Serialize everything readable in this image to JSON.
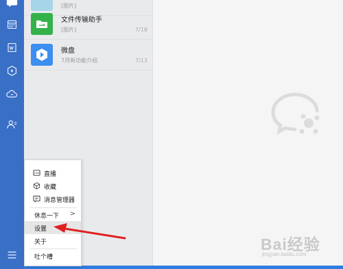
{
  "rail": {
    "color": "#3a6fc6",
    "icons": [
      "chat-icon",
      "calendar-icon",
      "document-icon",
      "play-icon",
      "cloud-icon",
      "contacts-icon",
      "menu-icon"
    ]
  },
  "conversations": [
    {
      "name": "",
      "subtitle": "[图片]",
      "time": "",
      "avatar_color": "#a7d5e8"
    },
    {
      "name": "文件传输助手",
      "subtitle": "[图片]",
      "time": "7/18",
      "avatar_color": "#35b14a"
    },
    {
      "name": "微盘",
      "subtitle": "7月新功能介绍",
      "time": "7/13",
      "avatar_color": "#3c8ef0"
    }
  ],
  "menu": {
    "items": [
      {
        "label": "直播",
        "icon": "live-icon"
      },
      {
        "label": "收藏",
        "icon": "cube-icon"
      },
      {
        "label": "消息管理器",
        "icon": "message-manager-icon"
      },
      {
        "label": "休息一下",
        "chevron": ">"
      },
      {
        "label": "设置"
      },
      {
        "label": "关于"
      },
      {
        "label": "吐个槽"
      }
    ]
  },
  "watermark": {
    "text": "Bai经验",
    "sub": "jingyan.baidu.com"
  },
  "accent": "#2f7de1",
  "arrow_color": "#e02020"
}
